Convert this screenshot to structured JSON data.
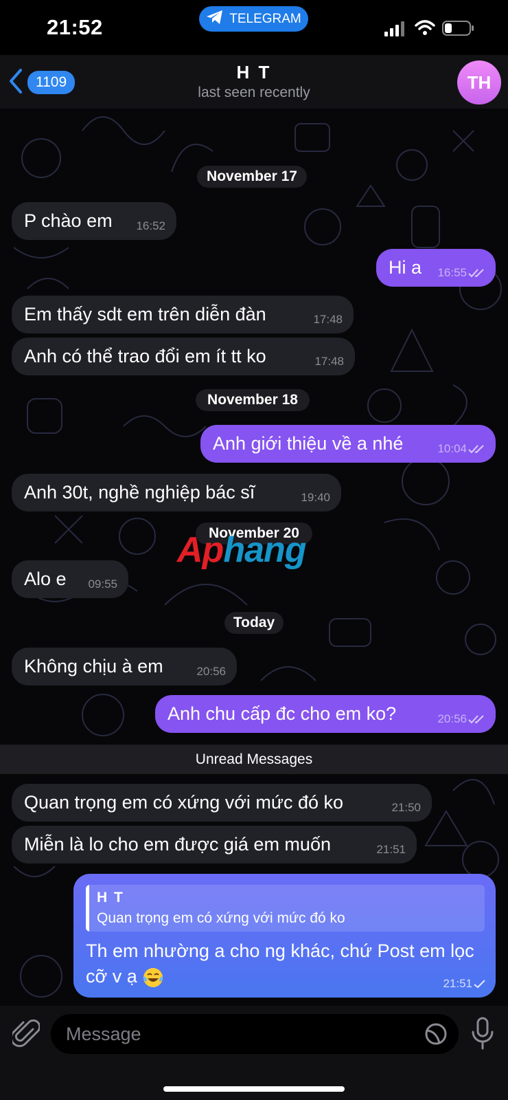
{
  "status_bar": {
    "time": "21:52",
    "app_label": "TELEGRAM"
  },
  "header": {
    "back_count": "1109",
    "contact_name": "H T",
    "contact_status": "last seen recently",
    "avatar_initials": "TH"
  },
  "dates": {
    "d1": "November 17",
    "d2": "November 18",
    "d3": "November 20",
    "d4": "Today"
  },
  "messages": [
    {
      "text": "P chào em",
      "time": "16:52",
      "dir": "in"
    },
    {
      "text": "Hi a",
      "time": "16:55",
      "dir": "out",
      "read": "double"
    },
    {
      "text": "Em thấy sdt em trên diễn đàn",
      "time": "17:48",
      "dir": "in"
    },
    {
      "text": "Anh có thể trao đổi em ít tt ko",
      "time": "17:48",
      "dir": "in"
    },
    {
      "text": "Anh giới thiệu về a nhé",
      "time": "10:04",
      "dir": "out",
      "read": "double"
    },
    {
      "text": "Anh 30t, nghề nghiệp bác sĩ",
      "time": "19:40",
      "dir": "in"
    },
    {
      "text": "Alo e",
      "time": "09:55",
      "dir": "in"
    },
    {
      "text": "Không chịu à em",
      "time": "20:56",
      "dir": "in"
    },
    {
      "text": "Anh chu cấp đc cho em ko?",
      "time": "20:56",
      "dir": "out",
      "read": "double"
    },
    {
      "text": "Quan trọng em có xứng với mức đó ko",
      "time": "21:50",
      "dir": "in"
    },
    {
      "text": "Miễn là lo cho em được giá em muốn",
      "time": "21:51",
      "dir": "in"
    }
  ],
  "unread_divider": "Unread Messages",
  "watermark": {
    "part1": "Ap",
    "part2": "hang"
  },
  "reply": {
    "quote_name": "H T",
    "quote_text": "Quan trọng em có xứng với mức đó ko",
    "text": "Th em nhường a cho ng khác, chứ Post em lọc cỡ v ạ",
    "emoji": "laughing-tears-emoji",
    "time": "21:51",
    "read": "single"
  },
  "input": {
    "placeholder": "Message"
  },
  "colors": {
    "incoming": "#212128",
    "outgoing": "#8654f0",
    "reply_gradient_top": "#6a6cf6",
    "reply_gradient_bottom": "#4a76f0",
    "accent": "#2f87ef"
  }
}
